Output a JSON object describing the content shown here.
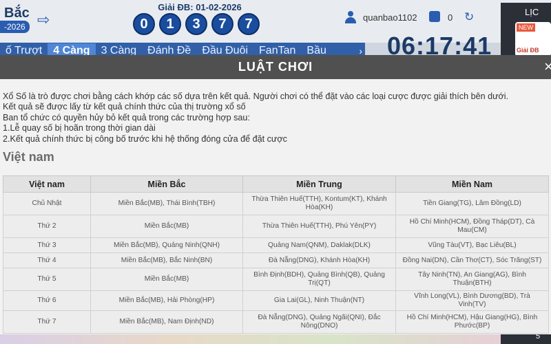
{
  "app": {
    "brand": "Bắc",
    "brand_date": "-2026",
    "giai_db_title": "Giải ĐB: 01-02-2026",
    "balls": [
      "0",
      "1",
      "3",
      "7",
      "7"
    ],
    "username": "quanbao1102",
    "wallet": "0",
    "clock": "06:17:41",
    "tabs": [
      {
        "label": "ố Trượt",
        "active": false
      },
      {
        "label": "4 Càng",
        "active": true
      },
      {
        "label": "3 Càng",
        "active": false
      },
      {
        "label": "Đánh Đề",
        "active": false
      },
      {
        "label": "Đầu Đuôi",
        "active": false
      },
      {
        "label": "FanTan",
        "active": false
      },
      {
        "label": "Bầu",
        "active": false
      }
    ],
    "side_label": "LỊC",
    "side_new": "NEW",
    "side_giai": "Giải ĐB",
    "side_page": "5"
  },
  "modal": {
    "title": "LUẬT CHƠI",
    "close_icon": "×",
    "intro_lines": [
      "Xổ Số là trò được chơi bằng cách khớp các số dựa trên kết quả. Người chơi có thể đặt vào các loại cược được giải thích bên dưới.",
      "Kết quả sẽ được lấy từ kết quả chính thức của thị trường xổ số",
      "Ban tổ chức có quyền hủy bỏ kết quả trong các trường hợp sau:",
      "1.Lễ quay số bị hoãn trong thời gian dài",
      "2.Kết quả chính thức bị công bố trước khi hệ thống đóng cửa để đặt cược"
    ],
    "section_title": "Việt nam",
    "table": {
      "headers": [
        "Việt nam",
        "Miền Bắc",
        "Miền Trung",
        "Miền Nam"
      ],
      "rows": [
        {
          "day": "Chủ Nhật",
          "bac": "Miền Bắc(MB), Thái Bình(TBH)",
          "trung": "Thừa Thiên Huế(TTH), Kontum(KT), Khánh Hòa(KH)",
          "nam": "Tiền Giang(TG), Lâm Đồng(LD)",
          "tall": true
        },
        {
          "day": "Thứ 2",
          "bac": "Miền Bắc(MB)",
          "trung": "Thừa Thiên Huế(TTH), Phú Yên(PY)",
          "nam": "Hồ Chí Minh(HCM), Đồng Tháp(DT), Cà Mau(CM)",
          "tall": true
        },
        {
          "day": "Thứ 3",
          "bac": "Miền Bắc(MB), Quảng Ninh(QNH)",
          "trung": "Quảng Nam(QNM), Daklak(DLK)",
          "nam": "Vũng Tàu(VT), Bạc Liêu(BL)",
          "tall": false
        },
        {
          "day": "Thứ 4",
          "bac": "Miền Bắc(MB), Bắc Ninh(BN)",
          "trung": "Đà Nẵng(DNG), Khánh Hòa(KH)",
          "nam": "Đồng Nai(DN), Cần Thơ(CT), Sóc Trăng(ST)",
          "tall": false
        },
        {
          "day": "Thứ 5",
          "bac": "Miền Bắc(MB)",
          "trung": "Bình Định(BDH), Quảng Bình(QB), Quảng Trị(QT)",
          "nam": "Tây Ninh(TN), An Giang(AG), Bình Thuận(BTH)",
          "tall": true
        },
        {
          "day": "Thứ 6",
          "bac": "Miền Bắc(MB), Hải Phòng(HP)",
          "trung": "Gia Lai(GL), Ninh Thuận(NT)",
          "nam": "Vĩnh Long(VL), Bình Dương(BD), Trà Vinh(TV)",
          "tall": false
        },
        {
          "day": "Thứ 7",
          "bac": "Miền Bắc(MB), Nam Định(ND)",
          "trung": "Đà Nẵng(DNG), Quảng Ngãi(QNI), Đắc Nông(DNO)",
          "nam": "Hồ Chí Minh(HCM), Hậu Giang(HG), Bình Phước(BP)",
          "tall": true
        }
      ]
    }
  },
  "colors": {
    "header_bg": "#505050",
    "ball_blue": "#1a4d9e",
    "brand_blue": "#2a5db0"
  }
}
